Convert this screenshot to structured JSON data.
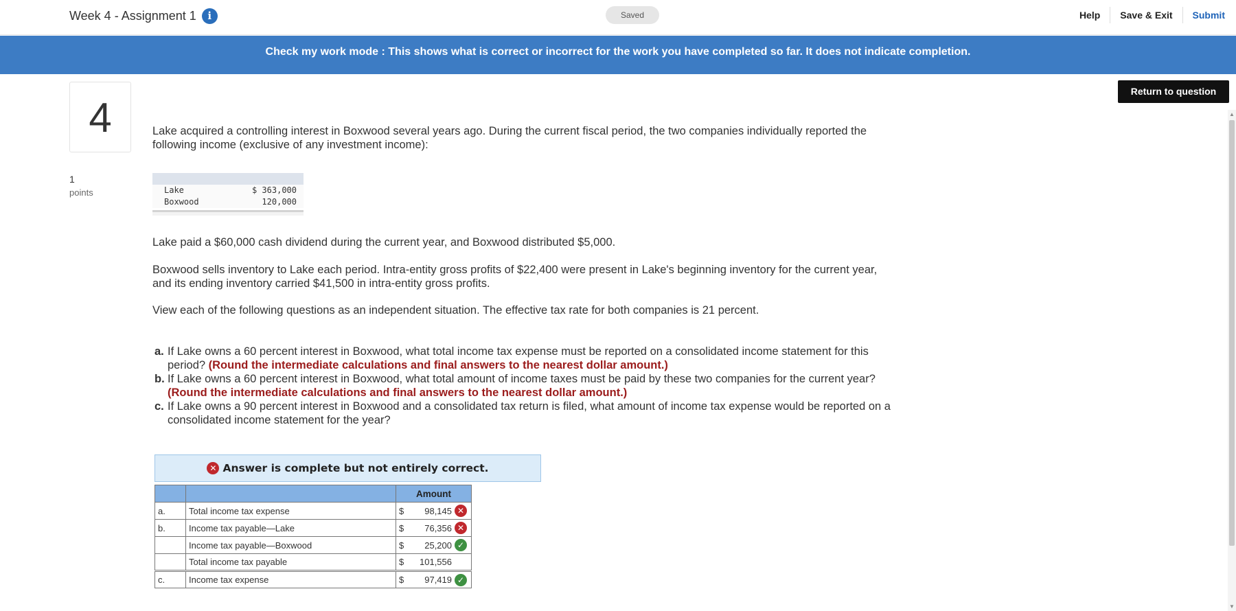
{
  "header": {
    "title": "Week 4 - Assignment 1",
    "saved_label": "Saved",
    "help_label": "Help",
    "save_exit_label": "Save & Exit",
    "submit_label": "Submit"
  },
  "banner": {
    "text": "Check my work mode : This shows what is correct or incorrect for the work you have completed so far. It does not indicate completion."
  },
  "return_button": "Return to question",
  "question": {
    "number": "4",
    "points_value": "1",
    "points_label": "points",
    "intro": "Lake acquired a controlling interest in Boxwood several years ago. During the current fiscal period, the two companies individually reported the following income (exclusive of any investment income):",
    "income_table": [
      {
        "name": "Lake",
        "value": "$ 363,000"
      },
      {
        "name": "Boxwood",
        "value": "120,000"
      }
    ],
    "para1": "Lake paid a $60,000 cash dividend during the current year, and Boxwood distributed $5,000.",
    "para2": "Boxwood sells inventory to Lake each period. Intra-entity gross profits of $22,400 were present in Lake's beginning inventory for the current year, and its ending inventory carried $41,500 in intra-entity gross profits.",
    "para3": "View each of the following questions as an independent situation. The effective tax rate for both companies is 21 percent.",
    "items": [
      {
        "label": "a.",
        "text": "If Lake owns a 60 percent interest in Boxwood, what total income tax expense must be reported on a consolidated income statement for this period?",
        "note": "(Round the intermediate calculations and final answers to the nearest dollar amount.)"
      },
      {
        "label": "b.",
        "text": "If Lake owns a 60 percent interest in Boxwood, what total amount of income taxes must be paid by these two companies for the current year?",
        "note": "(Round the intermediate calculations and final answers to the nearest dollar amount.)"
      },
      {
        "label": "c.",
        "text": "If Lake owns a 90 percent interest in Boxwood and a consolidated tax return is filed, what amount of income tax expense would be reported on a consolidated income statement for the year?",
        "note": ""
      }
    ]
  },
  "answer": {
    "status_text": "Answer is complete but not entirely correct.",
    "column_header": "Amount",
    "rows": [
      {
        "label": "a.",
        "desc": "Total income tax expense",
        "currency": "$",
        "amount": "98,145",
        "status": "incorrect"
      },
      {
        "label": "b.",
        "desc": "Income tax payable—Lake",
        "currency": "$",
        "amount": "76,356",
        "status": "incorrect"
      },
      {
        "label": "",
        "desc": "Income tax payable—Boxwood",
        "currency": "$",
        "amount": "25,200",
        "status": "correct"
      },
      {
        "label": "",
        "desc": "Total income tax payable",
        "currency": "$",
        "amount": "101,556",
        "status": "none"
      },
      {
        "label": "c.",
        "desc": "Income tax expense",
        "currency": "$",
        "amount": "97,419",
        "status": "correct"
      }
    ]
  },
  "icons": {
    "info": "info-icon",
    "incorrect": "x-circle-icon",
    "correct": "check-circle-icon"
  },
  "colors": {
    "banner": "#3d7cc4",
    "incorrect": "#c0282d",
    "correct": "#3e9142",
    "note_red": "#9b1c1c",
    "answer_header_bg": "#dcecf9",
    "table_header_bg": "#84b1e3"
  }
}
